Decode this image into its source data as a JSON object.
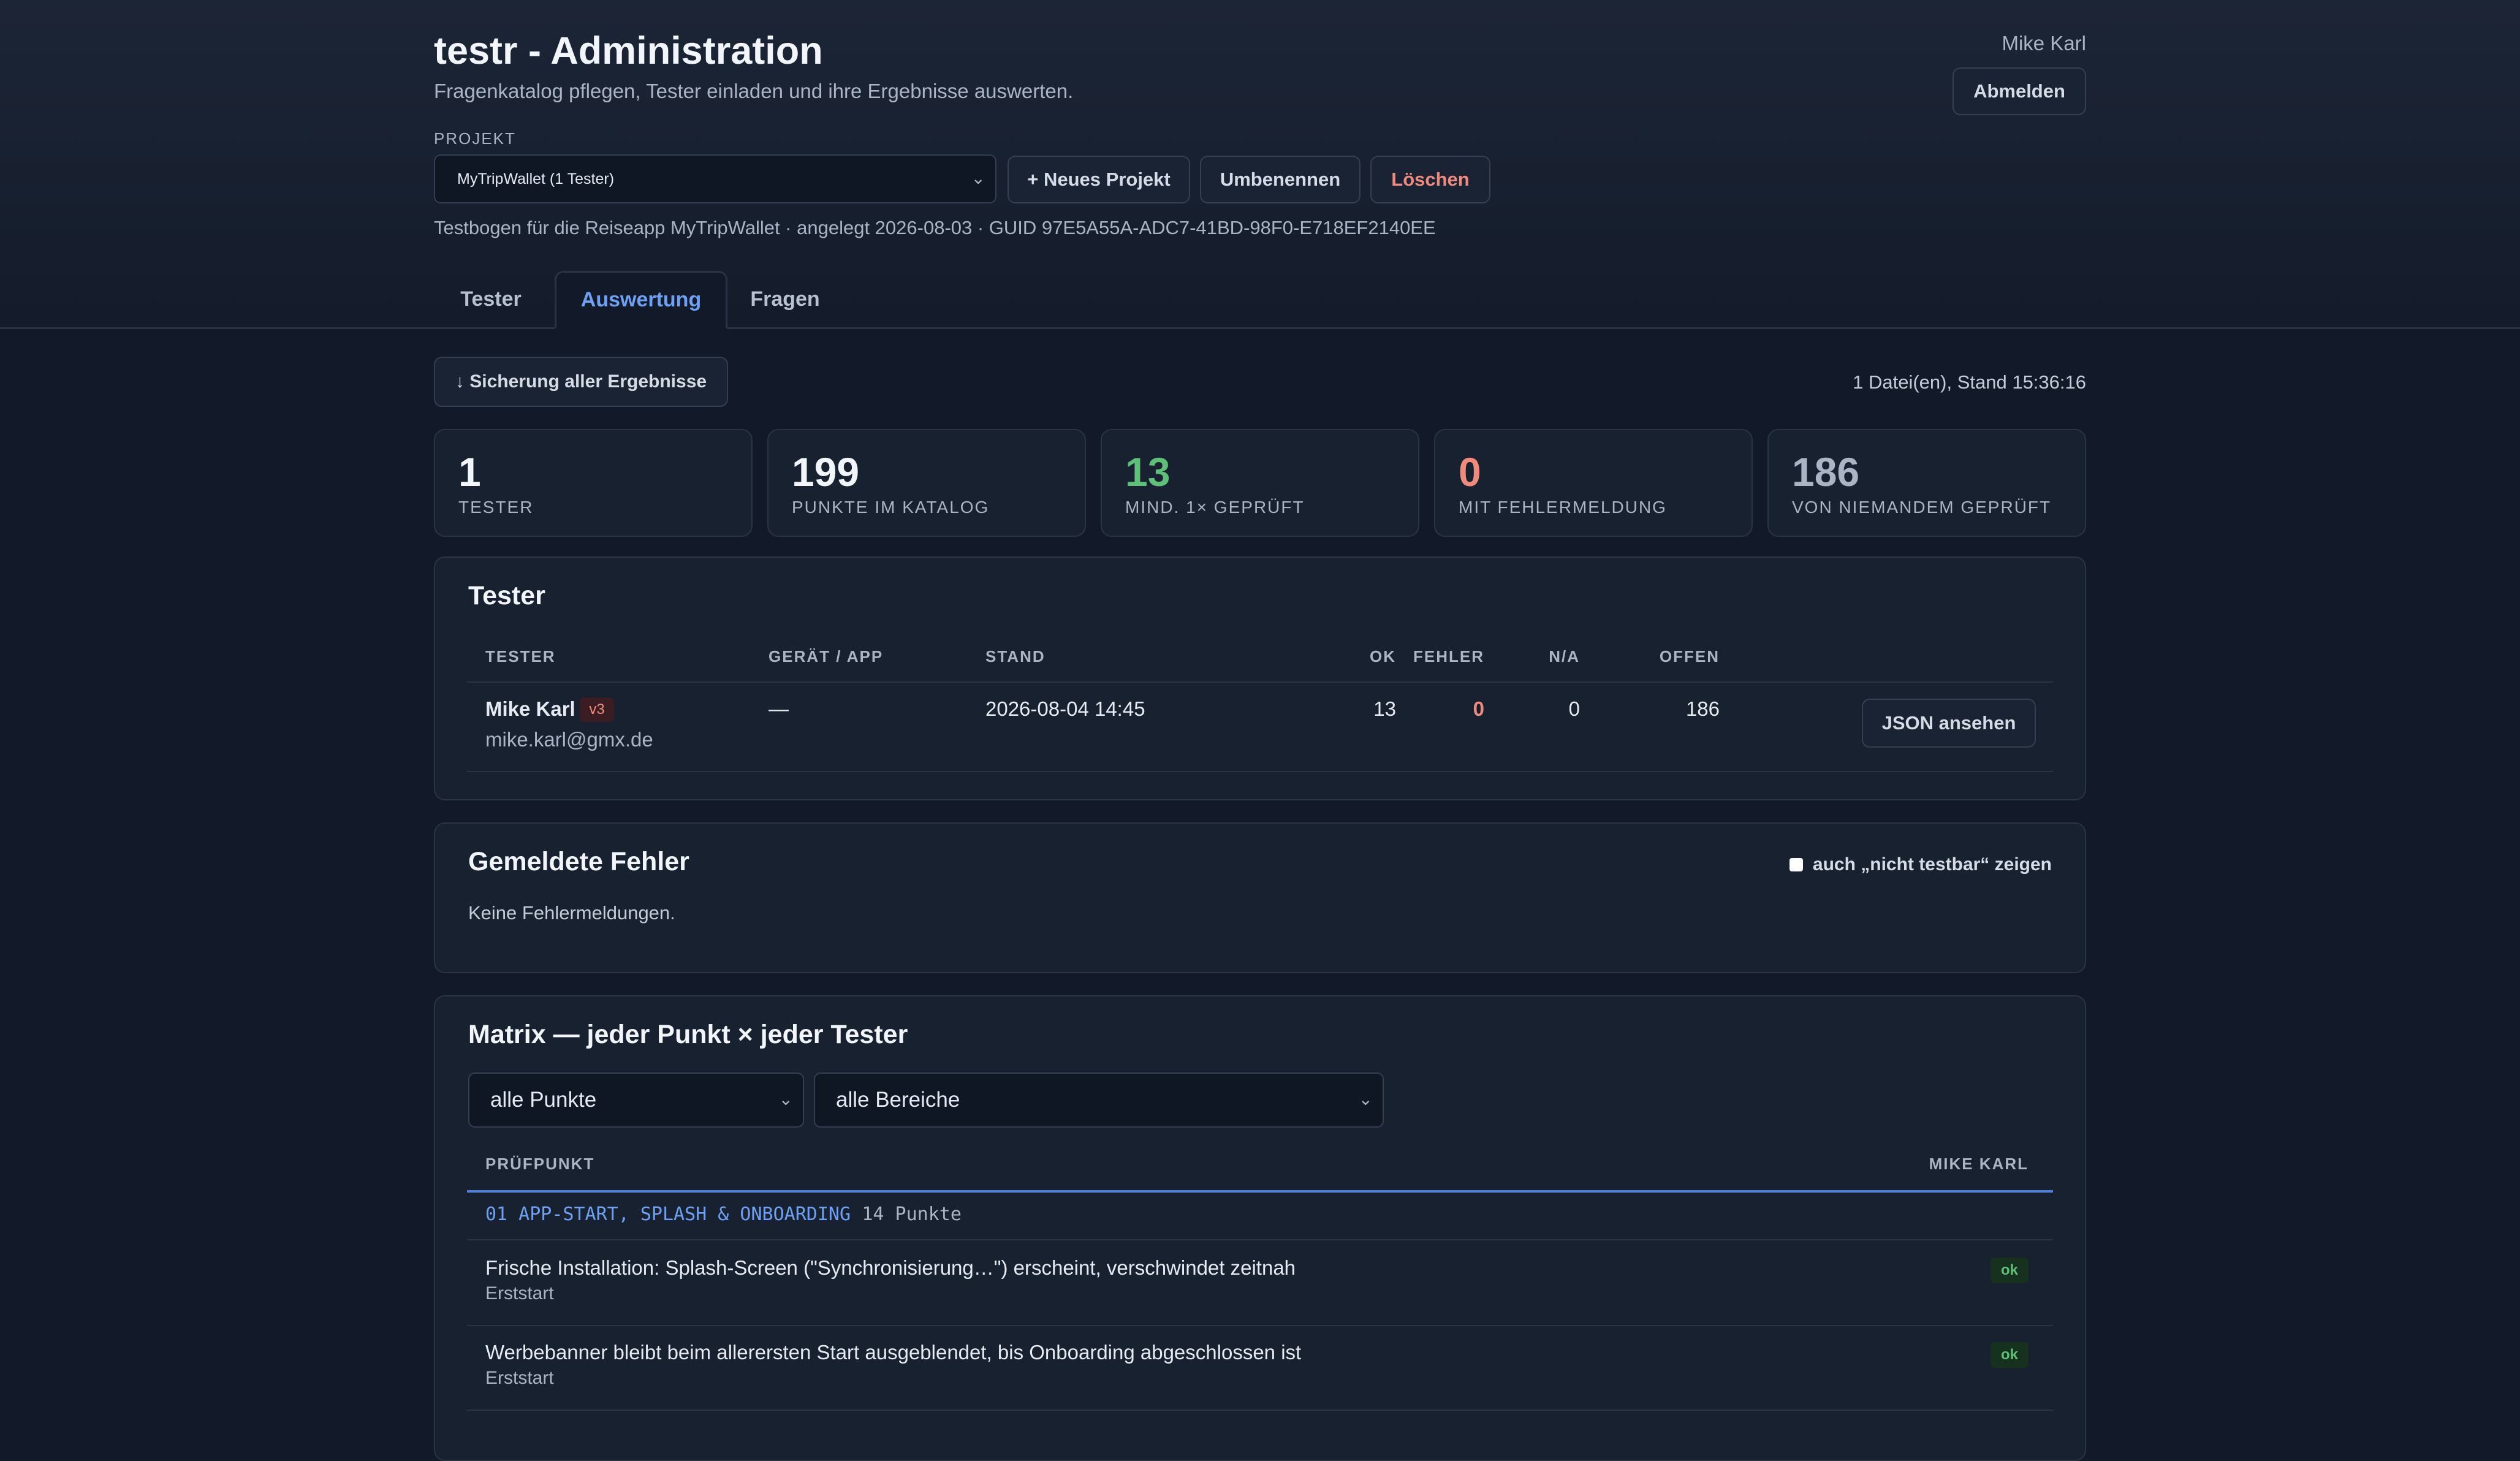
{
  "header": {
    "title": "testr - Administration",
    "subtitle": "Fragenkatalog pflegen, Tester einladen und ihre Ergebnisse auswerten.",
    "user_name": "Mike Karl",
    "logout_label": "Abmelden"
  },
  "project": {
    "label": "PROJEKT",
    "selected": "MyTripWallet (1 Tester)",
    "new_label": "+ Neues Projekt",
    "rename_label": "Umbenennen",
    "delete_label": "Löschen",
    "meta": "Testbogen für die Reiseapp MyTripWallet · angelegt 2026-08-03 · GUID 97E5A55A-ADC7-41BD-98F0-E718EF2140EE"
  },
  "tabs": [
    "Tester",
    "Auswertung",
    "Fragen"
  ],
  "toolbar": {
    "backup_label": "↓ Sicherung aller Ergebnisse",
    "status": "1 Datei(en), Stand 15:36:16"
  },
  "stats": [
    {
      "value": "1",
      "label": "TESTER",
      "color": "#f2f5fa"
    },
    {
      "value": "199",
      "label": "PUNKTE IM KATALOG",
      "color": "#f2f5fa"
    },
    {
      "value": "13",
      "label": "MIND. 1× GEPRÜFT",
      "color": "#5fbf78"
    },
    {
      "value": "0",
      "label": "MIT FEHLERMELDUNG",
      "color": "#f08a7a"
    },
    {
      "value": "186",
      "label": "VON NIEMANDEM GEPRÜFT",
      "color": "#aab4c5"
    }
  ],
  "tester_section": {
    "title": "Tester",
    "columns": [
      "TESTER",
      "GERÄT / APP",
      "STAND",
      "OK",
      "FEHLER",
      "N/A",
      "OFFEN"
    ],
    "rows": [
      {
        "name": "Mike Karl",
        "version": "v3",
        "email": "mike.karl@gmx.de",
        "device": "—",
        "stand": "2026-08-04 14:45",
        "ok": "13",
        "fehler": "0",
        "na": "0",
        "offen": "186",
        "action_label": "JSON ansehen"
      }
    ]
  },
  "errors_section": {
    "title": "Gemeldete Fehler",
    "checkbox_label": "auch „nicht testbar“ zeigen",
    "empty_text": "Keine Fehlermeldungen."
  },
  "matrix": {
    "title": "Matrix — jeder Punkt × jeder Tester",
    "filter_points": "alle Punkte",
    "filter_areas": "alle Bereiche",
    "col_point": "PRÜFPUNKT",
    "col_tester": "MIKE KARL",
    "group": {
      "name": "01 APP-START, SPLASH & ONBOARDING",
      "count": "14 Punkte"
    },
    "rows": [
      {
        "text": "Frische Installation: Splash-Screen (\"Synchronisierung…\") erscheint, verschwindet zeitnah",
        "sub": "Erststart",
        "status": "ok"
      },
      {
        "text": "Werbebanner bleibt beim allerersten Start ausgeblendet, bis Onboarding abgeschlossen ist",
        "sub": "Erststart",
        "status": "ok"
      }
    ]
  }
}
